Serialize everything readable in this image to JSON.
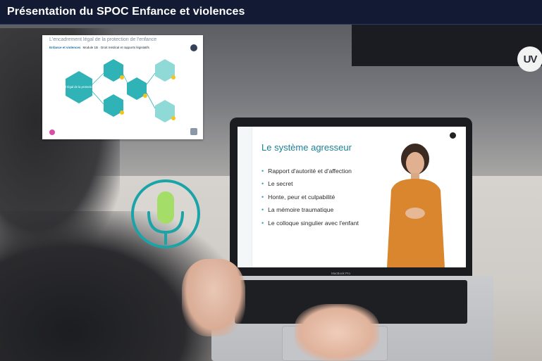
{
  "header": {
    "title": "Présentation du SPOC Enfance et violences"
  },
  "logo": {
    "text": "UV"
  },
  "slide_thumbnail": {
    "title": "L'encadrement légal de la protection de l'enfance",
    "course": "Enfance et violences",
    "module": "Module 1B · Droit médical et rapports législatifs",
    "center_hex": "L'encadrement légal de la protection de l'enfance",
    "colors": {
      "teal": "#2fb3b7",
      "light_teal": "#8fd9d6",
      "accent": "#f4c41b"
    }
  },
  "mic": {
    "icon": "microphone-icon",
    "color_ring": "#1aa4a8",
    "color_capsule": "#a4dd68"
  },
  "video_slide": {
    "title": "Le système agresseur",
    "bullets": [
      "Rapport d'autorité et d'affection",
      "Le secret",
      "Honte, peur et culpabilité",
      "La mémoire traumatique",
      "Le colloque singulier avec l'enfant"
    ],
    "title_color": "#1a7f95"
  },
  "laptop": {
    "brand": "MacBook Pro"
  }
}
